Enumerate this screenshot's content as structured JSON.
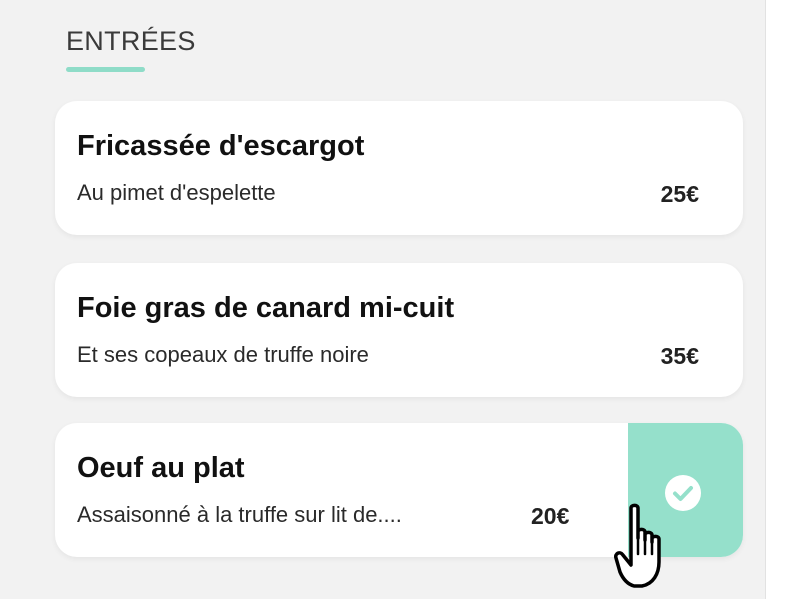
{
  "section": {
    "title": "ENTRÉES"
  },
  "colors": {
    "accent": "#8fdcc8",
    "selected_background": "#95e0cb",
    "card_background": "#ffffff",
    "page_background": "#f2f2f2"
  },
  "menu": {
    "items": [
      {
        "name": "Fricassée d'escargot",
        "description": "Au pimet d'espelette",
        "price": "25€",
        "selected": false
      },
      {
        "name": "Foie gras de canard mi-cuit",
        "description": "Et ses copeaux de truffe noire",
        "price": "35€",
        "selected": false
      },
      {
        "name": "Oeuf au plat",
        "description": "Assaisonné à la truffe sur lit de....",
        "price": "20€",
        "selected": true
      }
    ]
  },
  "icons": {
    "check": "check-circle-icon",
    "cursor": "hand-pointer-cursor"
  }
}
